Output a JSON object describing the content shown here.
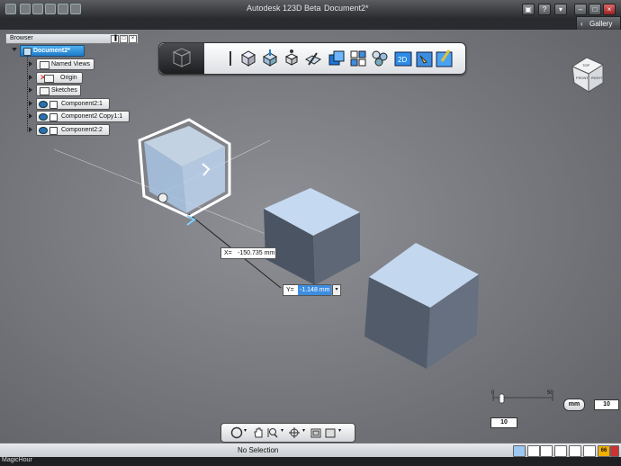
{
  "window": {
    "app_title": "Autodesk 123D Beta",
    "document_title": "Document2*",
    "gallery_label": "Gallery"
  },
  "browser": {
    "header": "Browser",
    "root": "Document2*",
    "items": [
      {
        "label": "Named Views"
      },
      {
        "label": "Origin"
      },
      {
        "label": "Sketches"
      },
      {
        "label": "Component2:1"
      },
      {
        "label": "Component2 Copy1:1"
      },
      {
        "label": "Component2:2"
      }
    ]
  },
  "viewcube": {
    "face_top": "TOP",
    "face_front": "FRONT",
    "face_right": "RIGHT"
  },
  "move_inputs": {
    "x_label": "X=",
    "x_value": "-150.735 mm",
    "y_label": "Y=",
    "y_value": "-1.148 mm"
  },
  "grid_ruler": {
    "tick_0": "0",
    "tick_50": "50",
    "unit": "mm",
    "major_value": "10",
    "minor_value": "10"
  },
  "status": {
    "selection_text": "No Selection",
    "value_badge": "66"
  },
  "taskbar": {
    "label": "MagicHour"
  },
  "colors": {
    "selected_tree_item": "#1e7cc8",
    "cube_face": "#aac6e8",
    "viewport_bg": "#808287"
  }
}
